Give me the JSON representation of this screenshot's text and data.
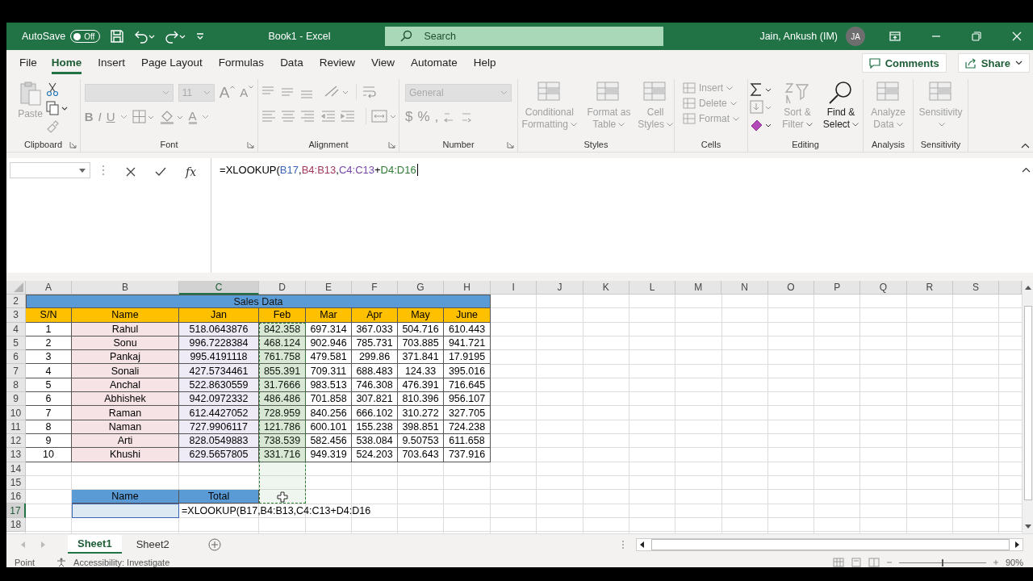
{
  "title_bar": {
    "autosave": {
      "label": "AutoSave",
      "on": false,
      "state": "Off"
    },
    "title": "Book1  -  Excel",
    "search": {
      "placeholder": "Search"
    },
    "user": "Jain, Ankush (IM)",
    "avatar": "JA"
  },
  "menu_tabs": [
    {
      "label": "File",
      "selected": false
    },
    {
      "label": "Home",
      "selected": true
    },
    {
      "label": "Insert",
      "selected": false
    },
    {
      "label": "Page Layout",
      "selected": false
    },
    {
      "label": "Formulas",
      "selected": false
    },
    {
      "label": "Data",
      "selected": false
    },
    {
      "label": "Review",
      "selected": false
    },
    {
      "label": "View",
      "selected": false
    },
    {
      "label": "Automate",
      "selected": false
    },
    {
      "label": "Help",
      "selected": false
    }
  ],
  "comments_button": "Comments",
  "share_button": "Share",
  "ribbon": {
    "groups": [
      {
        "kind": "clipboard",
        "label": "Clipboard",
        "paste": {
          "label": "Paste",
          "disabled": true
        }
      },
      {
        "kind": "font",
        "label": "Font",
        "font_size": "11",
        "grow": "A",
        "shrink": "A",
        "styles": [
          "B",
          "I",
          "U"
        ],
        "font_color": "A"
      },
      {
        "kind": "alignment",
        "label": "Alignment"
      },
      {
        "kind": "number",
        "label": "Number",
        "format": "General",
        "symbols": [
          "$",
          "%",
          ","
        ]
      },
      {
        "kind": "large_buttons",
        "label": "Styles",
        "buttons": [
          {
            "label": "Conditional Formatting",
            "disabled": true
          },
          {
            "label": "Format as Table",
            "disabled": true
          },
          {
            "label": "Cell Styles",
            "disabled": true
          }
        ]
      },
      {
        "kind": "cells",
        "label": "Cells",
        "buttons": [
          {
            "label": "Insert",
            "disabled": true
          },
          {
            "label": "Delete",
            "disabled": true
          },
          {
            "label": "Format",
            "disabled": true
          }
        ]
      },
      {
        "kind": "editing",
        "label": "Editing",
        "buttons": [
          {
            "label": "Sort & Filter",
            "disabled": true
          },
          {
            "label": "Find & Select",
            "disabled": false
          }
        ]
      },
      {
        "kind": "large_buttons",
        "label": "Analysis",
        "buttons": [
          {
            "label": "Analyze Data",
            "disabled": true
          }
        ]
      },
      {
        "kind": "large_buttons",
        "label": "Sensitivity",
        "buttons": [
          {
            "label": "Sensitivity",
            "disabled": true
          }
        ]
      }
    ]
  },
  "formula_bar": {
    "function_label": "fx",
    "parts": [
      {
        "text": "=XLOOKUP("
      },
      {
        "text": "B17",
        "color": "#3a66b5"
      },
      {
        "text": ","
      },
      {
        "text": "B4:B13",
        "color": "#a0395c"
      },
      {
        "text": ","
      },
      {
        "text": "C4:C13",
        "color": "#7747a8"
      },
      {
        "text": "+"
      },
      {
        "text": "D4:D16",
        "color": "#2e7d32"
      }
    ]
  },
  "sheet": {
    "columns": [
      {
        "label": "A",
        "selected": false
      },
      {
        "label": "B",
        "selected": false
      },
      {
        "label": "C",
        "selected": true
      },
      {
        "label": "D",
        "selected": false
      },
      {
        "label": "E",
        "selected": false
      },
      {
        "label": "F",
        "selected": false
      },
      {
        "label": "G",
        "selected": false
      },
      {
        "label": "H",
        "selected": false
      },
      {
        "label": "I",
        "selected": false
      },
      {
        "label": "J",
        "selected": false
      },
      {
        "label": "K",
        "selected": false
      },
      {
        "label": "L",
        "selected": false
      },
      {
        "label": "M",
        "selected": false
      },
      {
        "label": "N",
        "selected": false
      },
      {
        "label": "O",
        "selected": false
      },
      {
        "label": "P",
        "selected": false
      },
      {
        "label": "Q",
        "selected": false
      },
      {
        "label": "R",
        "selected": false
      },
      {
        "label": "S",
        "selected": false
      }
    ],
    "rows": [
      {
        "number": "2",
        "selected": false,
        "kind": "title",
        "cells": [
          "Sales Data"
        ]
      },
      {
        "number": "3",
        "selected": false,
        "kind": "header",
        "cells": [
          "S/N",
          "Name",
          "Jan",
          "Feb",
          "Mar",
          "Apr",
          "May",
          "June"
        ]
      },
      {
        "number": "4",
        "selected": false,
        "kind": "data",
        "cells": [
          "1",
          "Rahul",
          "518.0643876",
          "842.358",
          "697.314",
          "367.033",
          "504.716",
          "610.443"
        ]
      },
      {
        "number": "5",
        "selected": false,
        "kind": "data",
        "cells": [
          "2",
          "Sonu",
          "996.7228384",
          "468.124",
          "902.946",
          "785.731",
          "703.885",
          "941.721"
        ]
      },
      {
        "number": "6",
        "selected": false,
        "kind": "data",
        "cells": [
          "3",
          "Pankaj",
          "995.4191118",
          "761.758",
          "479.581",
          "299.86",
          "371.841",
          "17.9195"
        ]
      },
      {
        "number": "7",
        "selected": false,
        "kind": "data",
        "cells": [
          "4",
          "Sonali",
          "427.5734461",
          "855.391",
          "709.311",
          "688.483",
          "124.33",
          "395.016"
        ]
      },
      {
        "number": "8",
        "selected": false,
        "kind": "data",
        "cells": [
          "5",
          "Anchal",
          "522.8630559",
          "31.7666",
          "983.513",
          "746.308",
          "476.391",
          "716.645"
        ]
      },
      {
        "number": "9",
        "selected": false,
        "kind": "data",
        "cells": [
          "6",
          "Abhishek",
          "942.0972332",
          "486.486",
          "701.858",
          "307.821",
          "810.396",
          "956.107"
        ]
      },
      {
        "number": "10",
        "selected": false,
        "kind": "data",
        "cells": [
          "7",
          "Raman",
          "612.4427052",
          "728.959",
          "840.256",
          "666.102",
          "310.272",
          "327.705"
        ]
      },
      {
        "number": "11",
        "selected": false,
        "kind": "data",
        "cells": [
          "8",
          "Naman",
          "727.9906117",
          "121.786",
          "600.101",
          "155.238",
          "398.851",
          "724.238"
        ]
      },
      {
        "number": "12",
        "selected": false,
        "kind": "data",
        "cells": [
          "9",
          "Arti",
          "828.0549883",
          "738.539",
          "582.456",
          "538.084",
          "9.50753",
          "611.658"
        ]
      },
      {
        "number": "13",
        "selected": false,
        "kind": "data",
        "cells": [
          "10",
          "Khushi",
          "629.5657805",
          "331.716",
          "949.319",
          "524.203",
          "703.643",
          "737.916"
        ]
      },
      {
        "number": "14",
        "selected": false,
        "kind": "blank"
      },
      {
        "number": "15",
        "selected": false,
        "kind": "blank"
      },
      {
        "number": "16",
        "selected": false,
        "kind": "lookup_header",
        "cells": [
          "Name",
          "Total"
        ]
      },
      {
        "number": "17",
        "selected": true,
        "kind": "lookup_input",
        "formula": "=XLOOKUP(B17,B4:B13,C4:C13+D4:D16"
      },
      {
        "number": "18",
        "selected": false,
        "kind": "blank"
      }
    ]
  },
  "sheet_tabs": [
    {
      "label": "Sheet1",
      "selected": true
    },
    {
      "label": "Sheet2",
      "selected": false
    }
  ],
  "status_bar": {
    "mode": "Point",
    "accessibility": "Accessibility: Investigate",
    "zoom_slider": {
      "level": 0.5
    },
    "zoom": "90%"
  }
}
